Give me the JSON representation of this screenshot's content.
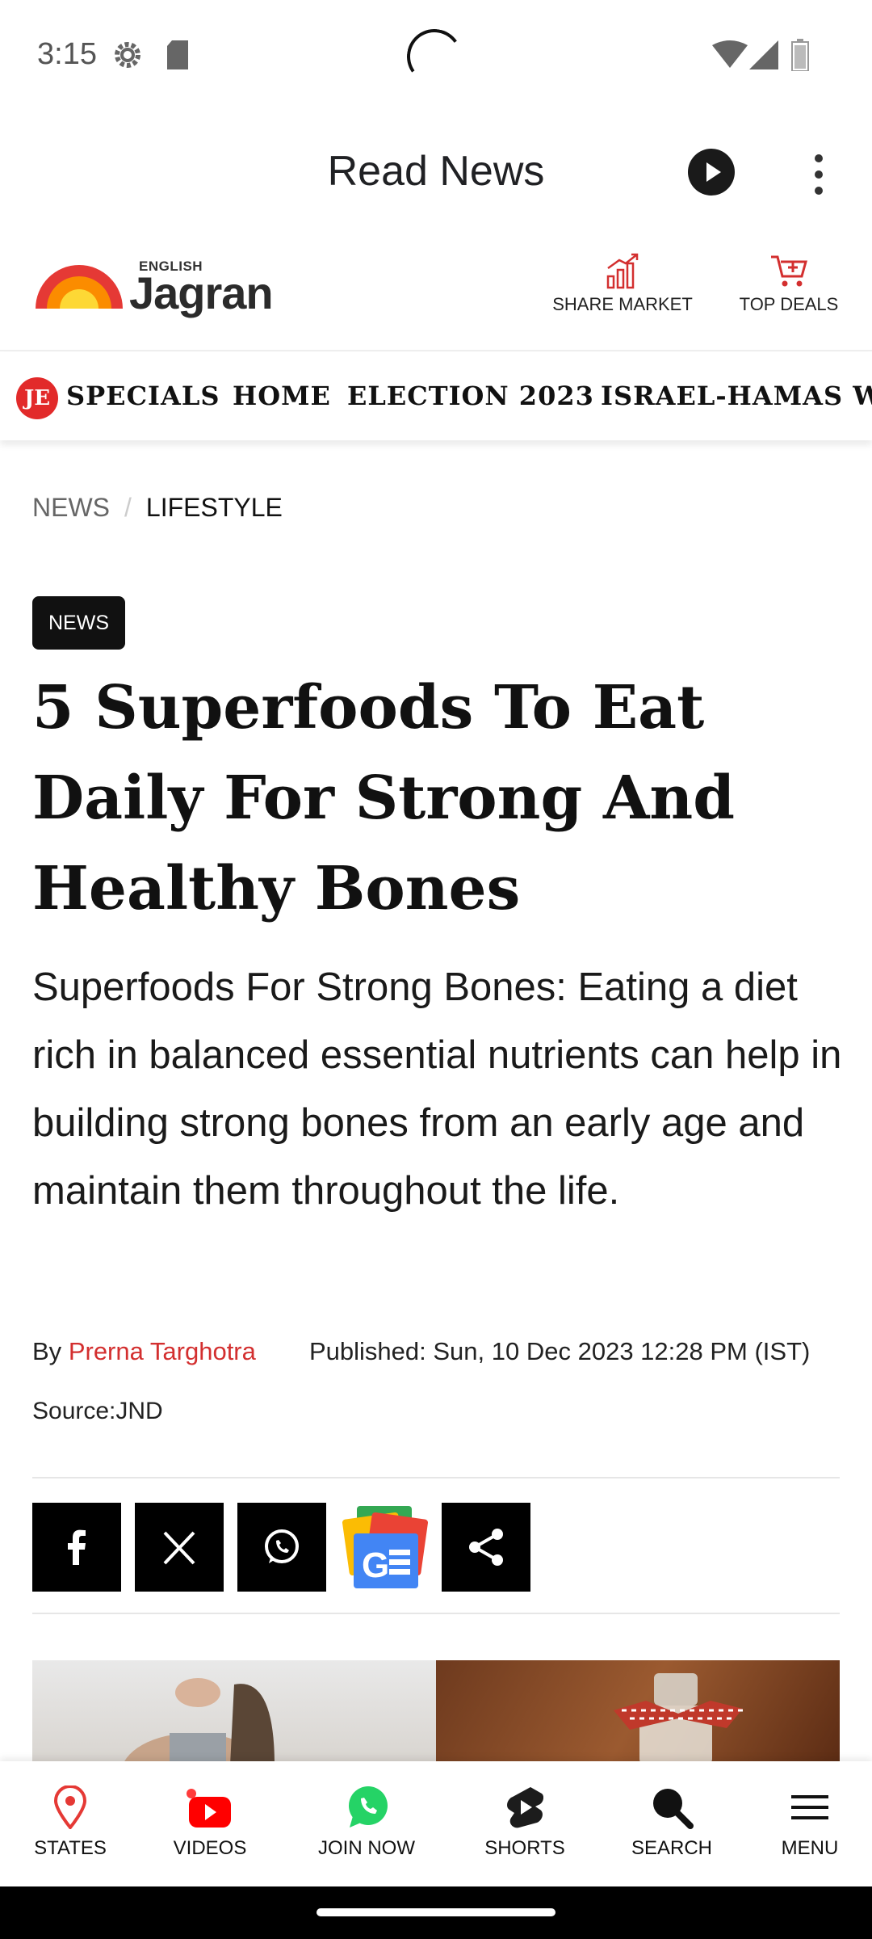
{
  "status_bar": {
    "time": "3:15"
  },
  "reader": {
    "title": "Read News"
  },
  "site": {
    "logo_top": "ENGLISH",
    "logo_name": "Jagran",
    "share_market": "SHARE MARKET",
    "top_deals": "TOP DEALS"
  },
  "nav": {
    "badge": "JE",
    "items": [
      "SPECIALS",
      "HOME",
      "ELECTION 2023",
      "ISRAEL-HAMAS W"
    ]
  },
  "breadcrumb": {
    "first": "NEWS",
    "second": "LIFESTYLE"
  },
  "article": {
    "badge": "NEWS",
    "headline": "5 Superfoods To Eat Daily For Strong And Healthy Bones",
    "summary": "Superfoods For Strong Bones: Eating a diet rich in balanced essential nutrients can help in building strong bones from an early age and maintain them throughout the life.",
    "by": "By",
    "author": "Prerna Targhotra",
    "published": "Published: Sun, 10 Dec 2023 12:28 PM (IST)",
    "source": "Source:JND"
  },
  "share_buttons": [
    "facebook-icon",
    "x-icon",
    "whatsapp-icon",
    "google-news-icon",
    "share-icon"
  ],
  "bottom_nav": {
    "states": "STATES",
    "videos": "VIDEOS",
    "join_now": "JOIN NOW",
    "shorts": "SHORTS",
    "search": "SEARCH",
    "menu": "MENU"
  },
  "colors": {
    "accent": "#d32f2f",
    "whatsapp": "#25d366",
    "youtube": "#ff0000"
  }
}
